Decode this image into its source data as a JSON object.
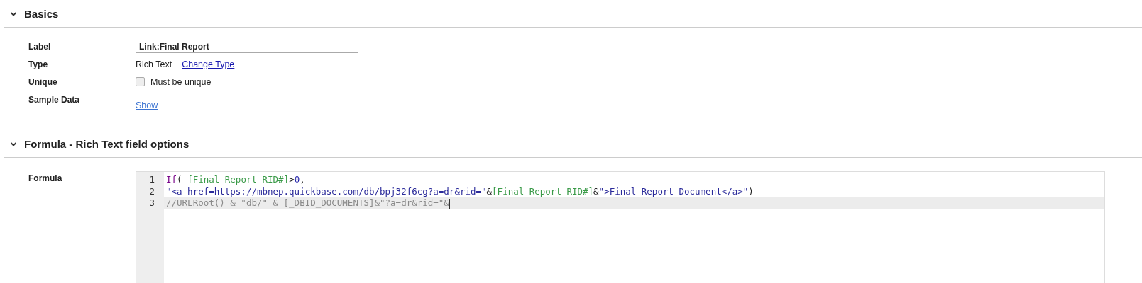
{
  "sections": [
    {
      "title": "Basics",
      "expanded": true,
      "kind": "basics"
    },
    {
      "title": "Formula - Rich Text field options",
      "expanded": true,
      "kind": "formula"
    }
  ],
  "basics": {
    "label": {
      "name": "Label",
      "value": "Link:Final Report"
    },
    "type": {
      "name": "Type",
      "value": "Rich Text",
      "link": "Change Type"
    },
    "unique": {
      "name": "Unique",
      "checked": false,
      "text": "Must be unique"
    },
    "sample": {
      "name": "Sample Data",
      "link": "Show"
    }
  },
  "formula": {
    "name": "Formula",
    "lines": [
      {
        "number": "1",
        "selected": false,
        "tokens": [
          {
            "kind": "keyword",
            "text": "If"
          },
          {
            "kind": "plain",
            "text": "( "
          },
          {
            "kind": "field",
            "text": "[Final Report RID#]"
          },
          {
            "kind": "plain",
            "text": ">"
          },
          {
            "kind": "number",
            "text": "0"
          },
          {
            "kind": "plain",
            "text": ","
          }
        ]
      },
      {
        "number": "2",
        "selected": false,
        "tokens": [
          {
            "kind": "string",
            "text": "\"<a href=https://mbnep.quickbase.com/db/bpj32f6cg?a=dr&rid=\""
          },
          {
            "kind": "plain",
            "text": "&"
          },
          {
            "kind": "field",
            "text": "[Final Report RID#]"
          },
          {
            "kind": "plain",
            "text": "&"
          },
          {
            "kind": "string",
            "text": "\">Final Report Document</a>\""
          },
          {
            "kind": "plain",
            "text": ")"
          }
        ]
      },
      {
        "number": "3",
        "selected": true,
        "tokens": [
          {
            "kind": "comment",
            "text": "//URLRoot() & \"db/\" & [_DBID_DOCUMENTS]&\"?a=dr&rid=\"&"
          }
        ]
      }
    ]
  }
}
